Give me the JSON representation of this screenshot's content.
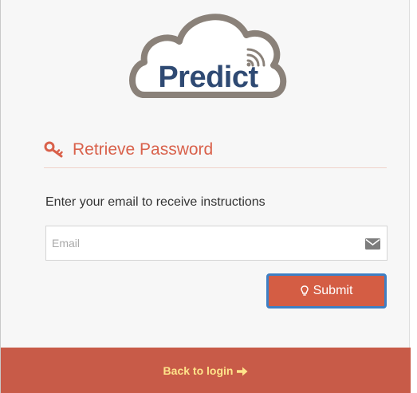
{
  "logo": {
    "text": "Predict"
  },
  "heading": {
    "title": "Retrieve Password",
    "icon": "key-icon"
  },
  "instructions": "Enter your email to receive instructions",
  "email": {
    "value": "",
    "placeholder": "Email",
    "icon": "envelope-icon"
  },
  "submit": {
    "label": "Submit",
    "icon": "lightbulb-icon"
  },
  "footer": {
    "back_label": "Back to login",
    "icon": "arrow-right-icon"
  },
  "colors": {
    "accent": "#d9614b",
    "button": "#d45d44",
    "button_focus_border": "#3e7fc4",
    "footer_bg": "#c85b48",
    "footer_text": "#ffe48a",
    "logo_text": "#2f4a73"
  }
}
